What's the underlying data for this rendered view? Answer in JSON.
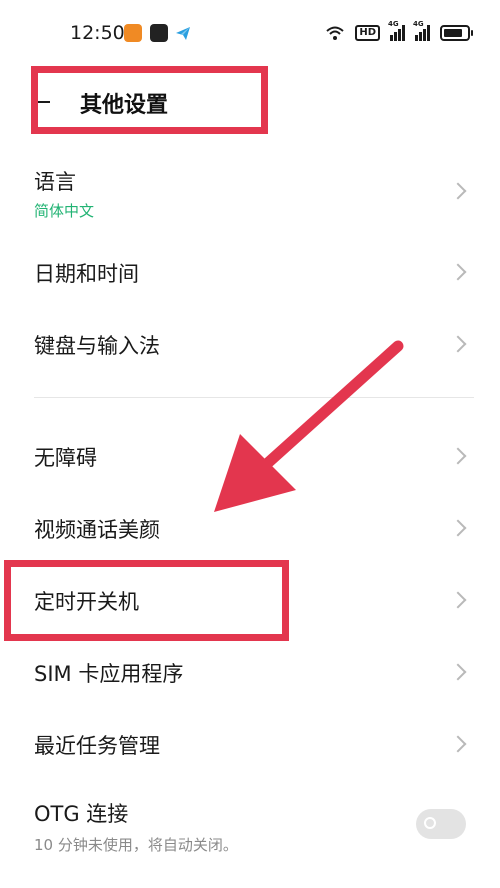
{
  "status_bar": {
    "time": "12:50",
    "hd_label": "HD",
    "signal_1_label": "4G",
    "signal_2_label": "4G",
    "icons": [
      "app-notification-icon",
      "app-notification-icon",
      "telegram-icon",
      "wifi-icon",
      "hd-icon",
      "signal-4g-icon",
      "signal-4g-icon",
      "battery-icon"
    ]
  },
  "header": {
    "back_icon": "back-icon",
    "title": "其他设置"
  },
  "settings": {
    "language": {
      "label": "语言",
      "value": "简体中文"
    },
    "datetime": {
      "label": "日期和时间"
    },
    "keyboard": {
      "label": "键盘与输入法"
    },
    "accessibility": {
      "label": "无障碍"
    },
    "video_beauty": {
      "label": "视频通话美颜"
    },
    "scheduled_power": {
      "label": "定时开关机"
    },
    "sim_apps": {
      "label": "SIM 卡应用程序"
    },
    "recent_tasks": {
      "label": "最近任务管理"
    },
    "otg": {
      "label": "OTG 连接",
      "description": "10 分钟未使用，将自动关闭。",
      "enabled": false
    }
  },
  "colors": {
    "annotation": "#e3364e",
    "accent_green": "#21b373",
    "chevron": "#b9b9b9"
  }
}
